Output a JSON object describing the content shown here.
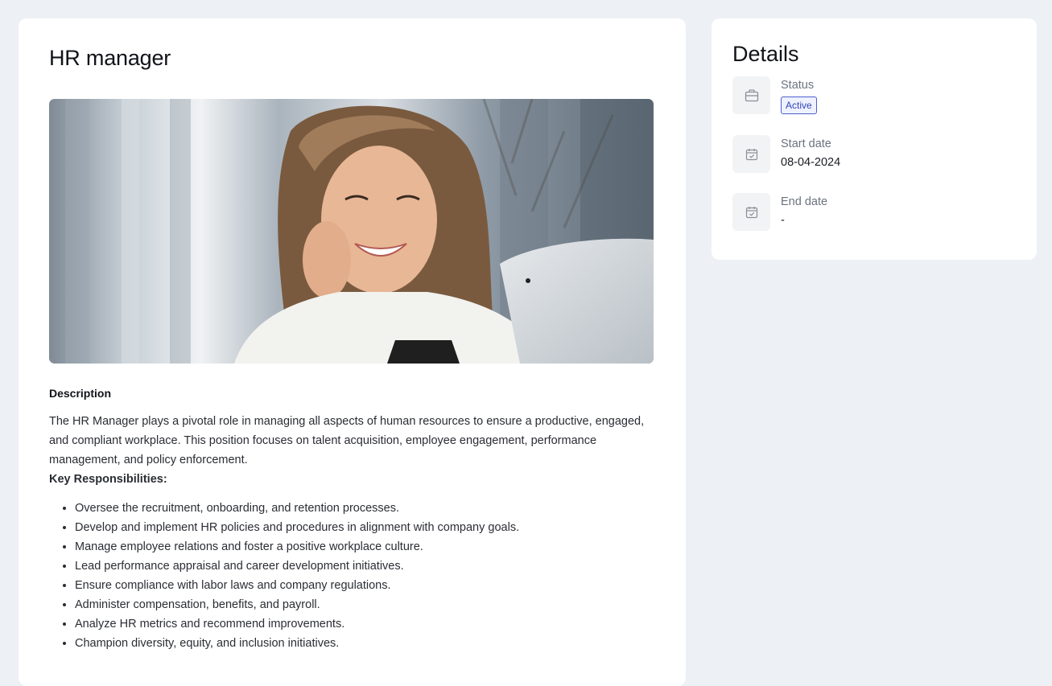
{
  "job": {
    "title": "HR manager",
    "description_heading": "Description",
    "description_text": "The HR Manager plays a pivotal role in managing all aspects of human resources to ensure a productive, engaged, and compliant workplace. This position focuses on talent acquisition, employee engagement, performance management, and policy enforcement.",
    "key_heading": "Key Responsibilities:",
    "responsibilities": [
      "Oversee the recruitment, onboarding, and retention processes.",
      "Develop and implement HR policies and procedures in alignment with company goals.",
      "Manage employee relations and foster a positive workplace culture.",
      "Lead performance appraisal and career development initiatives.",
      "Ensure compliance with labor laws and company regulations.",
      "Administer compensation, benefits, and payroll.",
      "Analyze HR metrics and recommend improvements.",
      "Champion diversity, equity, and inclusion initiatives."
    ]
  },
  "details": {
    "title": "Details",
    "status": {
      "label": "Status",
      "value": "Active",
      "icon": "briefcase-icon"
    },
    "start_date": {
      "label": "Start date",
      "value": "08-04-2024",
      "icon": "calendar-check-icon"
    },
    "end_date": {
      "label": "End date",
      "value": "-",
      "icon": "calendar-check-icon"
    }
  },
  "colors": {
    "background": "#edf0f5",
    "card": "#ffffff",
    "badge_border": "#4c5fd0",
    "badge_text": "#3347b8"
  }
}
